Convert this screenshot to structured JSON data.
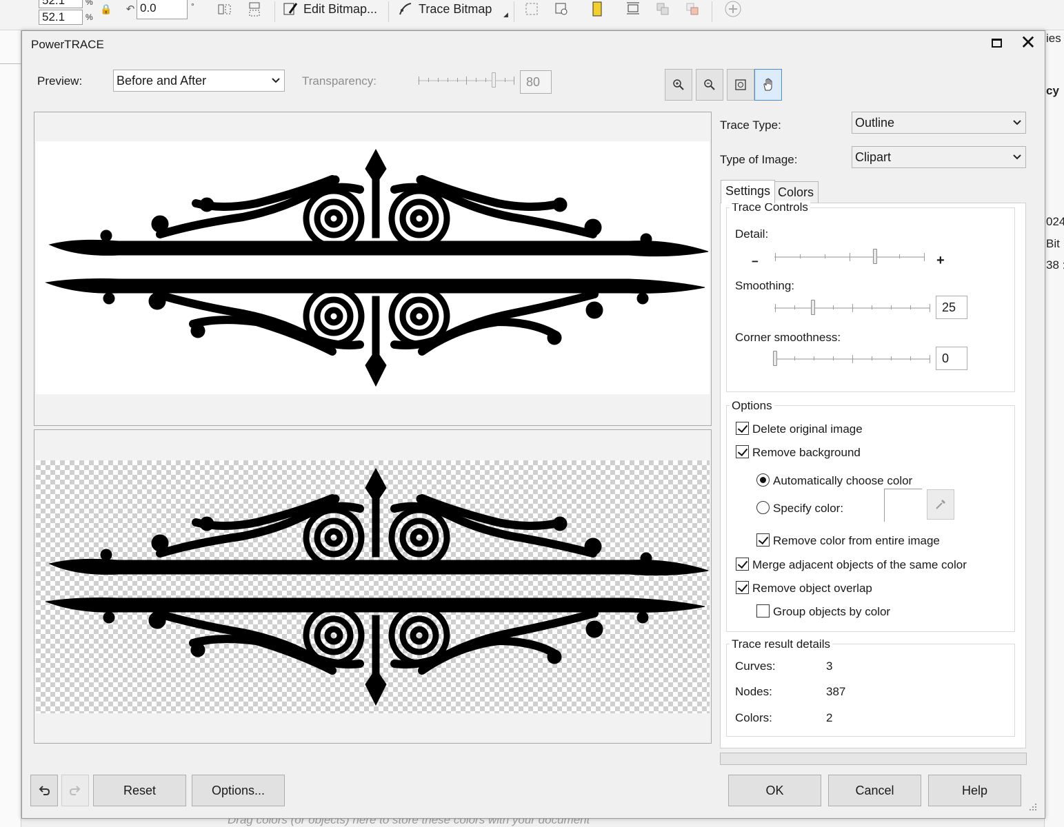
{
  "toolbar": {
    "field_top": "52.1",
    "field_bottom": "52.1",
    "unit_top": "%",
    "unit_bottom": "%",
    "rotation_value": "0.0",
    "rotation_unit": "°",
    "edit_bitmap_label": "Edit Bitmap...",
    "trace_bitmap_label": "Trace Bitmap"
  },
  "background": {
    "right_panel_texts": [
      "ies",
      "cy",
      "024",
      "Bit",
      "38 :"
    ],
    "bottom_hint": "Drag colors (or objects) here to store these colors with your document"
  },
  "dialog": {
    "title": "PowerTRACE",
    "preview_label": "Preview:",
    "preview_value": "Before and After",
    "transparency_label": "Transparency:",
    "transparency_value": "80",
    "transparency_level": 80,
    "trace_type_label": "Trace Type:",
    "trace_type_value": "Outline",
    "image_type_label": "Type of Image:",
    "image_type_value": "Clipart",
    "tabs": [
      {
        "label": "Settings",
        "selected": true
      },
      {
        "label": "Colors",
        "selected": false
      }
    ],
    "trace_controls": {
      "title": "Trace Controls",
      "detail_label": "Detail:",
      "detail_level": 0.68,
      "minus_label": "−",
      "plus_label": "+",
      "smoothing_label": "Smoothing:",
      "smoothing_value": "25",
      "corner_label": "Corner smoothness:",
      "corner_value": "0"
    },
    "options": {
      "title": "Options",
      "delete_original": {
        "label": "Delete original image",
        "checked": true
      },
      "remove_background": {
        "label": "Remove background",
        "checked": true
      },
      "auto_color": {
        "label": "Automatically choose color",
        "selected": true
      },
      "specify_color": {
        "label": "Specify color:",
        "selected": false
      },
      "remove_color_entire": {
        "label": "Remove color from entire image",
        "checked": true
      },
      "merge_adjacent": {
        "label": "Merge adjacent objects of the same color",
        "checked": true
      },
      "remove_overlap": {
        "label": "Remove object overlap",
        "checked": true
      },
      "group_by_color": {
        "label": "Group objects by color",
        "checked": false
      }
    },
    "results": {
      "title": "Trace result details",
      "curves_label": "Curves:",
      "curves_value": "3",
      "nodes_label": "Nodes:",
      "nodes_value": "387",
      "colors_label": "Colors:",
      "colors_value": "2"
    },
    "buttons": {
      "reset": "Reset",
      "options": "Options...",
      "ok": "OK",
      "cancel": "Cancel",
      "help": "Help"
    },
    "icons": [
      "zoom-in-icon",
      "zoom-out-icon",
      "fit-icon",
      "pan-hand-icon",
      "undo-icon",
      "redo-icon",
      "eyedropper-icon",
      "maximize-icon",
      "close-icon"
    ],
    "accent_color": "#4d8fd6"
  }
}
